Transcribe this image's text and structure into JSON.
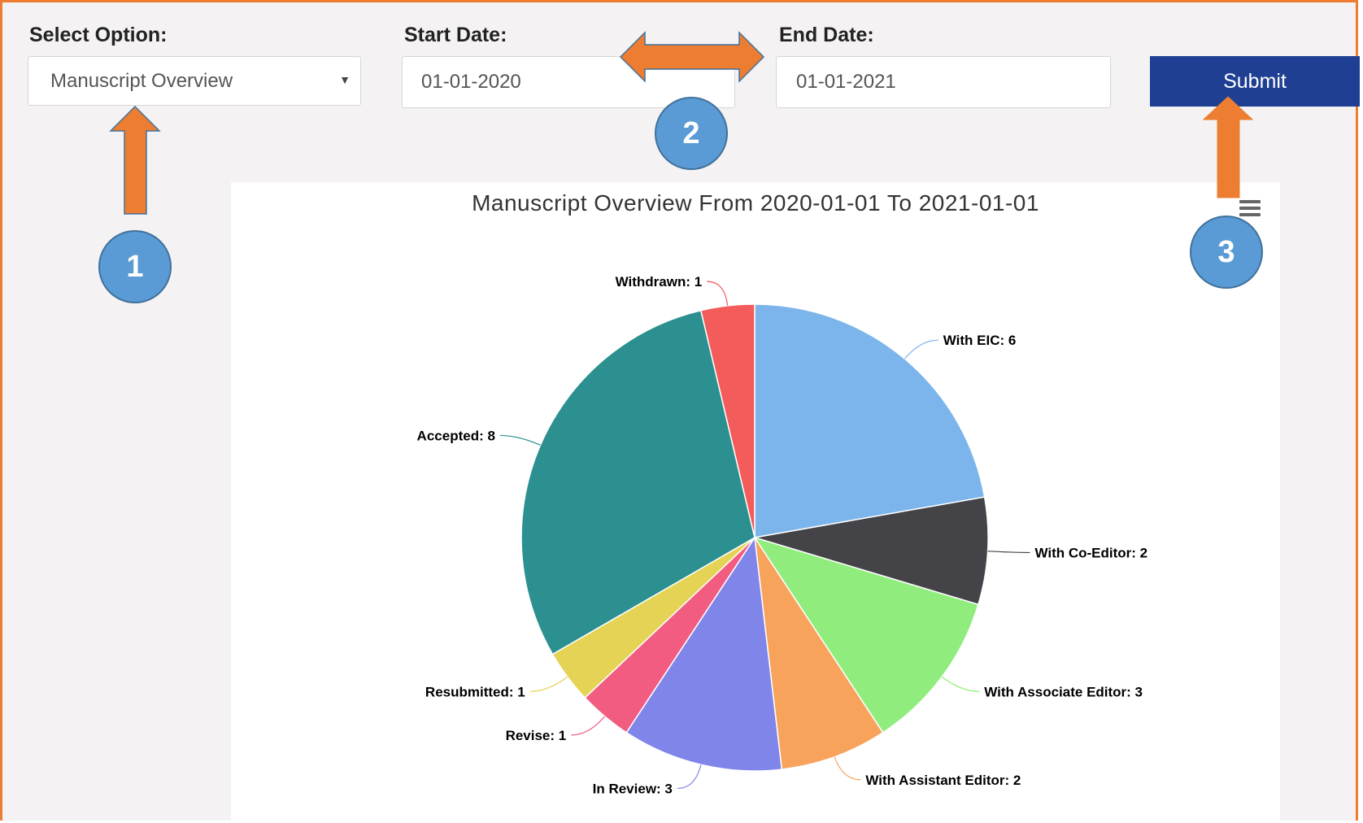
{
  "form": {
    "select_label": "Select Option:",
    "select_value": "Manuscript Overview",
    "start_label": "Start Date:",
    "start_value": "01-01-2020",
    "end_label": "End Date:",
    "end_value": "01-01-2021",
    "submit_label": "Submit"
  },
  "annotations": {
    "badge1": "1",
    "badge2": "2",
    "badge3": "3"
  },
  "colors": {
    "frame": "#ed7d31",
    "arrow": "#ed7d31",
    "badge": "#5b9bd5",
    "submit": "#1f3f93"
  },
  "chart_data": {
    "type": "pie",
    "title": "Manuscript Overview From 2020-01-01 To 2021-01-01",
    "slices": [
      {
        "label": "With EIC",
        "value": 6,
        "color": "#7cb5ec"
      },
      {
        "label": "With Co-Editor",
        "value": 2,
        "color": "#434348"
      },
      {
        "label": "With Associate Editor",
        "value": 3,
        "color": "#90ed7d"
      },
      {
        "label": "With Assistant Editor",
        "value": 2,
        "color": "#f7a35c"
      },
      {
        "label": "In Review",
        "value": 3,
        "color": "#8085e9"
      },
      {
        "label": "Revise",
        "value": 1,
        "color": "#f15c80"
      },
      {
        "label": "Resubmitted",
        "value": 1,
        "color": "#e4d354"
      },
      {
        "label": "Accepted",
        "value": 8,
        "color": "#2b908f"
      },
      {
        "label": "Withdrawn",
        "value": 1,
        "color": "#f45b5b"
      }
    ],
    "data_labels": [
      "With EIC: 6",
      "With Co-Editor: 2",
      "With Associate Editor: 3",
      "With Assistant Editor: 2",
      "In Review: 3",
      "Revise: 1",
      "Resubmitted: 1",
      "Accepted: 8",
      "Withdrawn: 1"
    ]
  }
}
